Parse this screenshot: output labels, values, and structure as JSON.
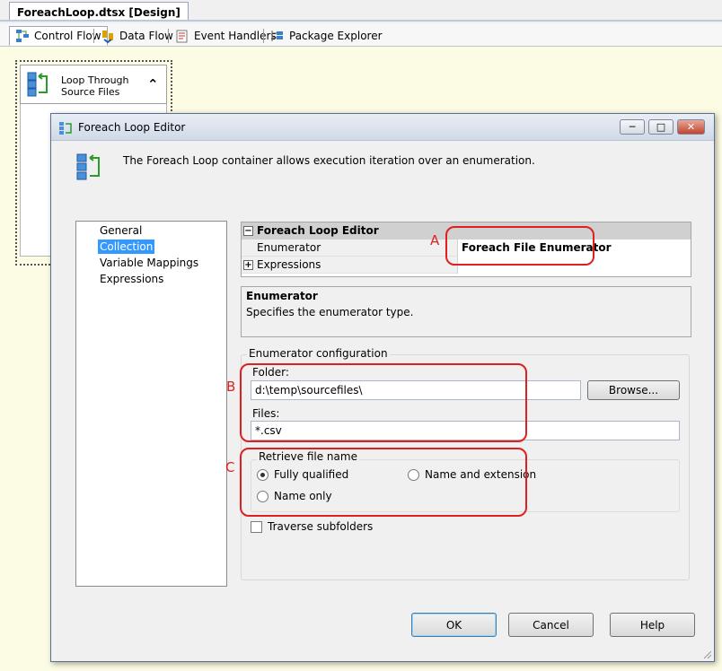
{
  "document_tab": {
    "title": "ForeachLoop.dtsx [Design]"
  },
  "designer_tabs": [
    {
      "label": "Control Flow",
      "icon": "control-flow-icon",
      "active": true
    },
    {
      "label": "Data Flow",
      "icon": "data-flow-icon"
    },
    {
      "label": "Event Handlers",
      "icon": "event-handlers-icon"
    },
    {
      "label": "Package Explorer",
      "icon": "package-explorer-icon"
    }
  ],
  "task": {
    "label_line1": "Loop Through",
    "label_line2": "Source Files"
  },
  "dialog": {
    "title": "Foreach Loop Editor",
    "description": "The Foreach Loop container allows execution iteration over an enumeration.",
    "nav": [
      "General",
      "Collection",
      "Variable Mappings",
      "Expressions"
    ],
    "nav_selected": "Collection",
    "property_grid": {
      "category": "Foreach Loop Editor",
      "rows": [
        {
          "name": "Enumerator",
          "value": "Foreach File Enumerator"
        },
        {
          "name": "Expressions",
          "value": ""
        }
      ]
    },
    "help": {
      "title": "Enumerator",
      "text": "Specifies the enumerator type."
    },
    "enumerator_config": {
      "group_title": "Enumerator configuration",
      "folder_label": "Folder:",
      "folder_value": "d:\\temp\\sourcefiles\\",
      "browse_label": "Browse...",
      "files_label": "Files:",
      "files_value": "*.csv",
      "retrieve": {
        "title": "Retrieve file name",
        "options": [
          "Fully qualified",
          "Name and extension",
          "Name only"
        ],
        "selected": "Fully qualified"
      },
      "traverse_label": "Traverse subfolders",
      "traverse_checked": false
    },
    "buttons": {
      "ok": "OK",
      "cancel": "Cancel",
      "help": "Help"
    }
  },
  "annotations": [
    "A",
    "B",
    "C"
  ],
  "colors": {
    "annotation": "#e02020",
    "selection": "#3399ff",
    "canvas": "#fcfbe4"
  }
}
